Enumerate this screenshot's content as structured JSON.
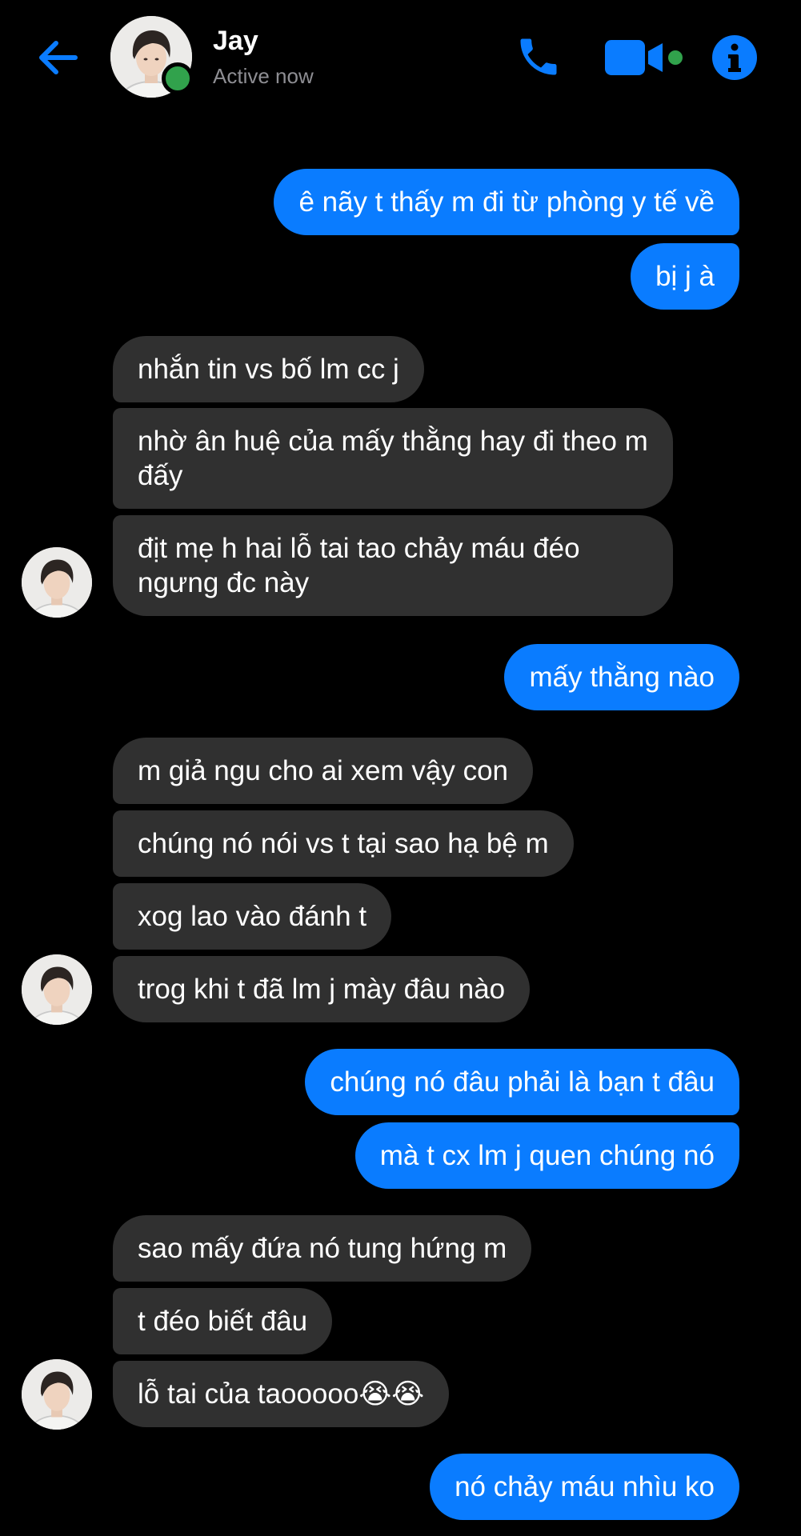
{
  "header": {
    "contact_name": "Jay",
    "status": "Active now",
    "icons": [
      "back-arrow-icon",
      "phone-icon",
      "video-camera-icon",
      "info-icon"
    ]
  },
  "colors": {
    "accent": "#0a7cff",
    "incoming_bubble": "#303030",
    "online": "#31a24c",
    "background": "#000000"
  },
  "messages": [
    {
      "dir": "out",
      "text": "ê nãy t thấy m đi từ phòng y tế về"
    },
    {
      "dir": "out",
      "text": "bị j à"
    },
    {
      "dir": "in",
      "text": "nhắn tin vs bố lm cc j"
    },
    {
      "dir": "in",
      "text": "nhờ ân huệ của mấy thằng hay đi theo m đấy"
    },
    {
      "dir": "in",
      "text": "địt mẹ h hai lỗ tai tao chảy máu đéo ngưng đc này"
    },
    {
      "dir": "out",
      "text": "mấy thằng nào"
    },
    {
      "dir": "in",
      "text": "m giả ngu cho ai xem vậy con"
    },
    {
      "dir": "in",
      "text": "chúng nó nói vs t tại sao hạ bệ m"
    },
    {
      "dir": "in",
      "text": "xog lao vào đánh t"
    },
    {
      "dir": "in",
      "text": "trog khi t đã lm j mày đâu nào"
    },
    {
      "dir": "out",
      "text": "chúng nó đâu phải là bạn t đâu"
    },
    {
      "dir": "out",
      "text": "mà t cx lm j quen chúng nó"
    },
    {
      "dir": "in",
      "text": "sao mấy đứa nó tung hứng m"
    },
    {
      "dir": "in",
      "text": "t đéo biết đâu"
    },
    {
      "dir": "in",
      "text": "lỗ tai của taooooo😭😭"
    },
    {
      "dir": "out",
      "text": "nó chảy máu nhìu ko"
    }
  ]
}
